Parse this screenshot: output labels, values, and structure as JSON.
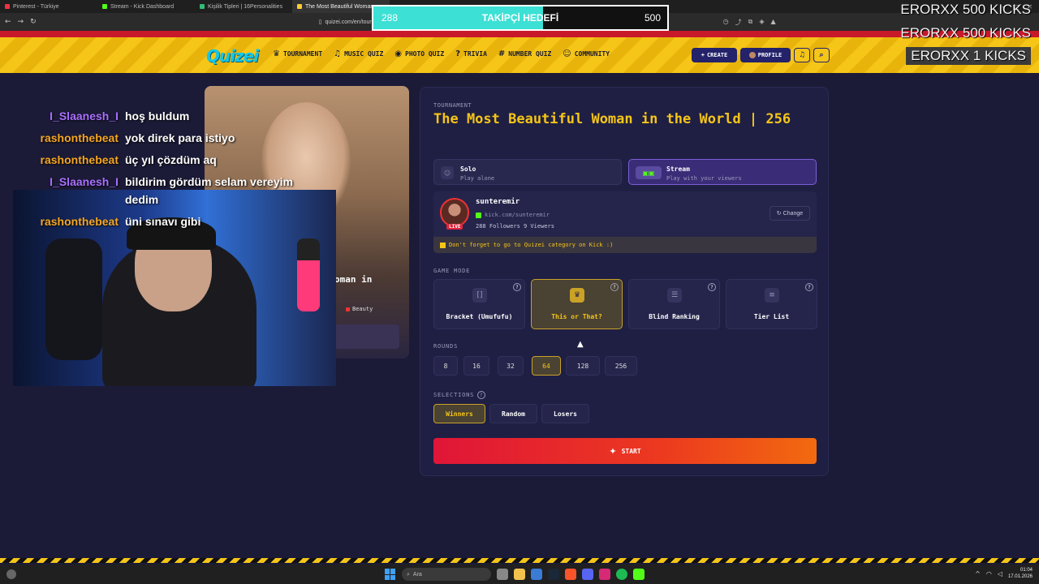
{
  "browser": {
    "tabs": [
      {
        "label": "Pinterest - Türkiye",
        "active": false
      },
      {
        "label": "Stream - Kick Dashboard",
        "active": false
      },
      {
        "label": "Kişilik Tipleri | 16Personalities",
        "active": false
      },
      {
        "label": "The Most Beautiful Woman",
        "active": true
      }
    ],
    "url": "quizei.com/en/tournam"
  },
  "header": {
    "logo": "Quizei",
    "nav": [
      {
        "icon": "trophy-icon",
        "label": "TOURNAMENT"
      },
      {
        "icon": "music-icon",
        "label": "MUSIC QUIZ"
      },
      {
        "icon": "camera-icon",
        "label": "PHOTO QUIZ"
      },
      {
        "icon": "question-icon",
        "label": "TRIVIA"
      },
      {
        "icon": "hash-icon",
        "label": "NUMBER QUIZ"
      },
      {
        "icon": "users-icon",
        "label": "COMMUNITY"
      }
    ],
    "create_label": "CREATE",
    "profile_label": "PROFILE"
  },
  "overlay": {
    "goal_current": "288",
    "goal_title": "TAKİPÇİ HEDEFİ",
    "goal_max": "500",
    "goal_progress": 0.576,
    "kick_alerts": [
      "ERORXX  500 KICKS",
      "ERORXX  500 KICKS",
      "ERORXX  1 KICKS"
    ]
  },
  "background_card": {
    "title_fragment": "oman in",
    "tag": "Beauty"
  },
  "chat": [
    {
      "user": "I_Slaanesh_I",
      "color": "#a970ff",
      "message": "hoş buldum"
    },
    {
      "user": "rashonthebeat",
      "color": "#f5a623",
      "message": "yok direk para istiyo"
    },
    {
      "user": "rashonthebeat",
      "color": "#f5a623",
      "message": "üç yıl çözdüm aq"
    },
    {
      "user": "I_Slaanesh_I",
      "color": "#a970ff",
      "message": "bildirim gördüm selam vereyim dedim"
    },
    {
      "user": "rashonthebeat",
      "color": "#f5a623",
      "message": "üni sınavı gibi"
    }
  ],
  "tournament": {
    "eyebrow": "TOURNAMENT",
    "title": "The Most Beautiful Woman in the World | 256",
    "modes": [
      {
        "name": "Solo",
        "sub": "Play alone",
        "selected": false
      },
      {
        "name": "Stream",
        "sub": "Play with your viewers",
        "selected": true
      }
    ],
    "streamer": {
      "name": "sunteremir",
      "live_badge": "LIVE",
      "url": "kick.com/sunteremir",
      "stats": "288 Followers 9 Viewers",
      "change_label": "Change",
      "notice": "Don't forget to go to Quizei category on Kick :)"
    },
    "game_mode_label": "GAME MODE",
    "game_modes": [
      {
        "name": "Bracket (Umufufu)",
        "icon": "bracket-icon",
        "selected": false
      },
      {
        "name": "This or That?",
        "icon": "crown-icon",
        "selected": true
      },
      {
        "name": "Blind Ranking",
        "icon": "list-icon",
        "selected": false
      },
      {
        "name": "Tier List",
        "icon": "layers-icon",
        "selected": false
      }
    ],
    "rounds_label": "ROUNDS",
    "rounds": [
      {
        "value": "8",
        "selected": false
      },
      {
        "value": "16",
        "selected": false
      },
      {
        "value": "32",
        "selected": false
      },
      {
        "value": "64",
        "selected": true
      },
      {
        "value": "128",
        "selected": false
      },
      {
        "value": "256",
        "selected": false
      }
    ],
    "selections_label": "SELECTIONS",
    "selections": [
      {
        "label": "Winners",
        "selected": true
      },
      {
        "label": "Random",
        "selected": false
      },
      {
        "label": "Losers",
        "selected": false
      }
    ],
    "start_label": "START"
  },
  "taskbar": {
    "search_placeholder": "Ara",
    "time": "01:04",
    "date": "17.01.2026"
  }
}
